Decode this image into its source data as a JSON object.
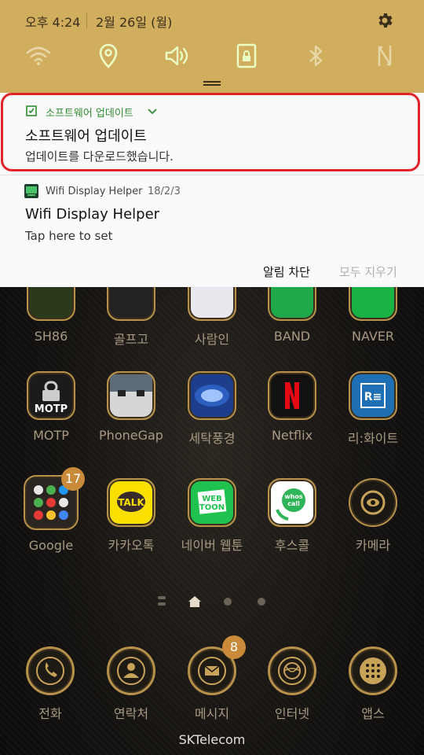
{
  "status_bar": {
    "time": "오후 4:24",
    "date": "2월 26일 (월)"
  },
  "quick_settings": [
    "wifi-icon",
    "location-icon",
    "sound-icon",
    "rotation-lock-icon",
    "bluetooth-icon",
    "nfc-icon"
  ],
  "notifications": [
    {
      "app_name": "소프트웨어 업데이트",
      "title": "소프트웨어 업데이트",
      "text": "업데이트를 다운로드했습니다."
    },
    {
      "app_name": "Wifi Display Helper",
      "time": "18/2/3",
      "title": "Wifi Display Helper",
      "text": "Tap here to set"
    }
  ],
  "actions": {
    "block": "알림 차단",
    "clear_all": "모두 지우기"
  },
  "home": {
    "row1": [
      "SH86",
      "골프고",
      "사람인",
      "BAND",
      "NAVER"
    ],
    "row2": [
      "MOTP",
      "PhoneGap",
      "세탁풍경",
      "Netflix",
      "리:화이트"
    ],
    "row3": [
      "Google",
      "카카오톡",
      "네이버 웹툰",
      "후스콜",
      "카메라"
    ],
    "badges": {
      "google": "17",
      "messages": "8"
    },
    "dock": [
      "전화",
      "연락처",
      "메시지",
      "인터넷",
      "앱스"
    ],
    "carrier": "SKTelecom"
  },
  "colors": {
    "shade": "#d1ad5e",
    "accent_green": "#2e8b30",
    "highlight_red": "#e0242a"
  }
}
